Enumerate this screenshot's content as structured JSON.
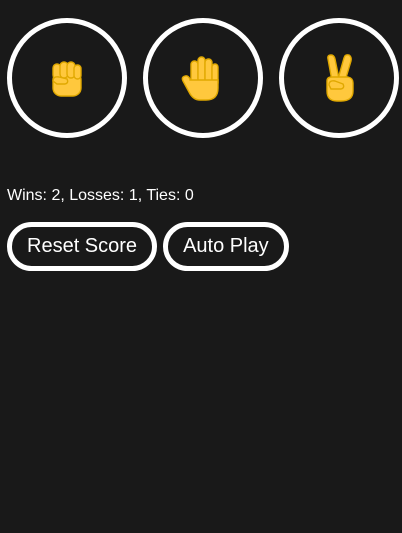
{
  "moves": [
    {
      "name": "rock",
      "icon": "raised-fist-icon"
    },
    {
      "name": "paper",
      "icon": "raised-hand-icon"
    },
    {
      "name": "scissors",
      "icon": "victory-hand-icon"
    }
  ],
  "score": {
    "text": "Wins: 2, Losses: 1, Ties: 0",
    "wins": 2,
    "losses": 1,
    "ties": 0
  },
  "controls": {
    "reset_label": "Reset Score",
    "auto_play_label": "Auto Play"
  },
  "colors": {
    "background": "#191919",
    "border": "#ffffff",
    "emoji_skin": "#FFC83D",
    "emoji_outline": "#E0A800"
  }
}
